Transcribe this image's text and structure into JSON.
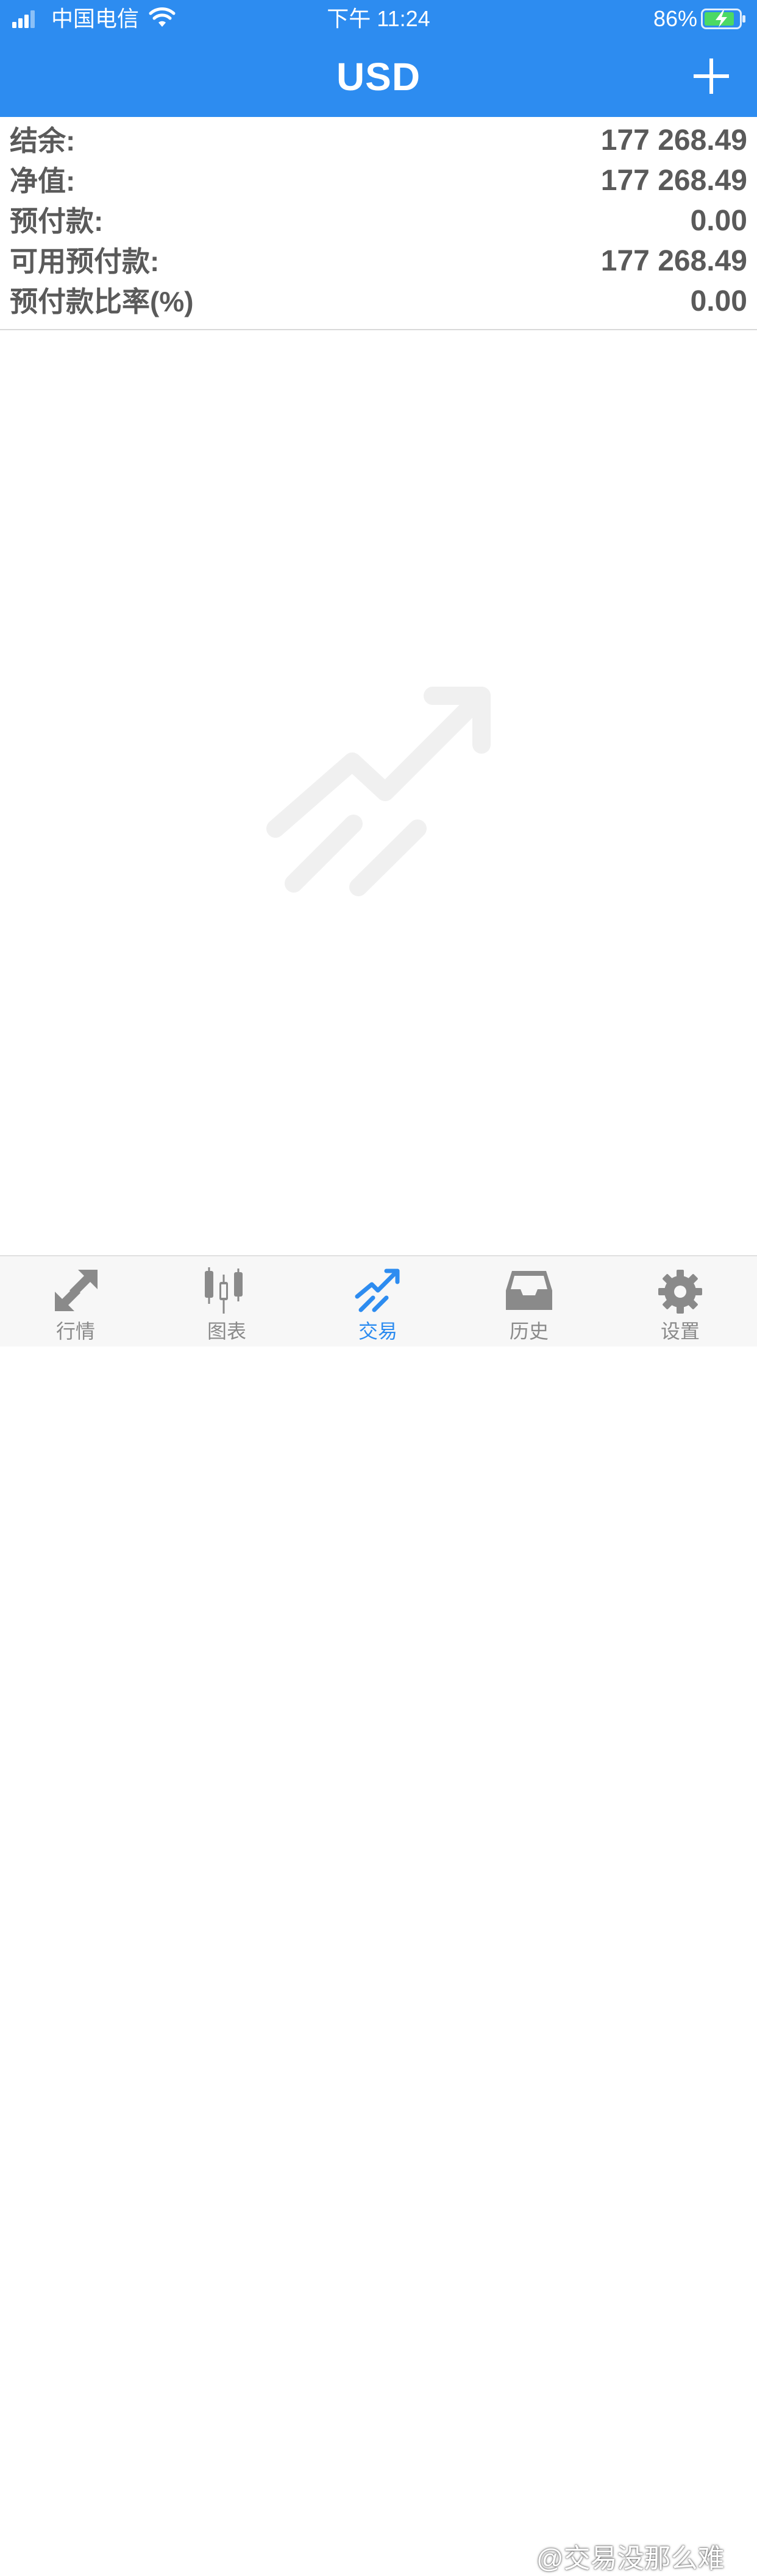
{
  "status_bar": {
    "carrier": "中国电信",
    "time": "下午 11:24",
    "battery_percent": "86%",
    "icons": [
      "signal-icon",
      "wifi-icon",
      "battery-charging-icon"
    ]
  },
  "nav": {
    "title": "USD",
    "add_icon": "plus-icon"
  },
  "account_summary": {
    "rows": [
      {
        "label": "结余:",
        "value": "177 268.49"
      },
      {
        "label": "净值:",
        "value": "177 268.49"
      },
      {
        "label": "预付款:",
        "value": "0.00"
      },
      {
        "label": "可用预付款:",
        "value": "177 268.49"
      },
      {
        "label": "预付款比率(%)",
        "value": "0.00"
      }
    ]
  },
  "empty_state": {
    "icon": "trade-trend-icon"
  },
  "tab_bar": {
    "active": "交易",
    "tabs": [
      {
        "label": "行情",
        "icon": "quotes-arrows-icon"
      },
      {
        "label": "图表",
        "icon": "candlestick-icon"
      },
      {
        "label": "交易",
        "icon": "trade-trend-icon"
      },
      {
        "label": "历史",
        "icon": "inbox-icon"
      },
      {
        "label": "设置",
        "icon": "gear-icon"
      }
    ]
  },
  "watermark": "@交易没那么难",
  "colors": {
    "header": "#2d8cf0",
    "active_tab": "#2d8cf0",
    "inactive_tab": "#8a8a8a",
    "battery_charge": "#4cd964",
    "text": "#5a5a5a"
  }
}
